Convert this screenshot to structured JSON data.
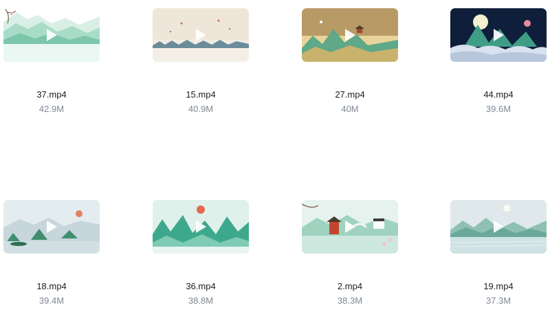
{
  "files": [
    {
      "name": "37.mp4",
      "size": "42.9M",
      "thumbnail": "misty-green-mountains-branch"
    },
    {
      "name": "15.mp4",
      "size": "40.9M",
      "thumbnail": "beige-sky-distant-hills"
    },
    {
      "name": "27.mp4",
      "size": "40M",
      "thumbnail": "golden-sky-green-peaks-pavilion"
    },
    {
      "name": "44.mp4",
      "size": "39.6M",
      "thumbnail": "night-moon-clouds-peaks"
    },
    {
      "name": "18.mp4",
      "size": "39.4M",
      "thumbnail": "pale-lake-islands-red-sun"
    },
    {
      "name": "36.mp4",
      "size": "38.8M",
      "thumbnail": "teal-peaks-red-sun"
    },
    {
      "name": "2.mp4",
      "size": "38.3M",
      "thumbnail": "red-pavilion-bridge-blossoms"
    },
    {
      "name": "19.mp4",
      "size": "37.3M",
      "thumbnail": "sunny-lake-mountains"
    }
  ],
  "icons": {
    "play": "play-icon"
  },
  "colors": {
    "filename": "#1d1d1f",
    "filesize": "#7f8794",
    "background": "#ffffff"
  }
}
